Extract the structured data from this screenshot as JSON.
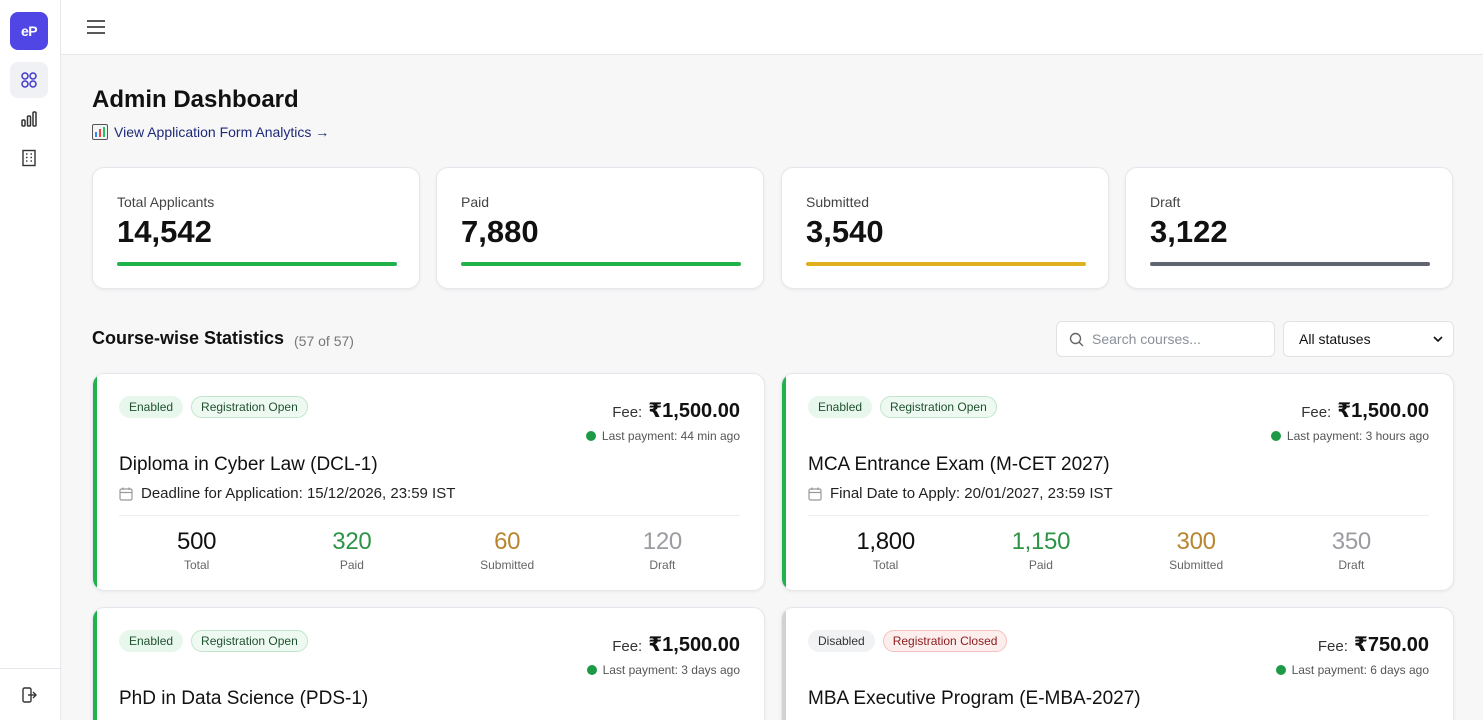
{
  "app": {
    "logo_text": "eP"
  },
  "sidebar": {
    "items": [
      {
        "icon": "dashboard-grid-icon",
        "active": true
      },
      {
        "icon": "bar-chart-icon",
        "active": false
      },
      {
        "icon": "building-icon",
        "active": false
      }
    ],
    "bottom_icon": "logout-icon"
  },
  "topbar": {
    "menu_icon": "hamburger-menu-icon"
  },
  "header": {
    "title": "Admin Dashboard",
    "analytics_link": "View Application Form Analytics →"
  },
  "stats": [
    {
      "label": "Total Applicants",
      "value": "14,542",
      "color": "#22b24c"
    },
    {
      "label": "Paid",
      "value": "7,880",
      "color": "#22b24c"
    },
    {
      "label": "Submitted",
      "value": "3,540",
      "color": "#e0b01f"
    },
    {
      "label": "Draft",
      "value": "3,122",
      "color": "#5f6470"
    }
  ],
  "section": {
    "title": "Course-wise Statistics",
    "count": "(57 of 57)",
    "search_placeholder": "Search courses...",
    "status_filter": "All statuses"
  },
  "courses": [
    {
      "status_badge": "Enabled",
      "registration_badge": "Registration Open",
      "fee_label": "Fee:",
      "fee": "₹1,500.00",
      "last_payment": "Last payment: 44 min ago",
      "title": "Diploma in Cyber Law (DCL-1)",
      "deadline": "Deadline for Application: 15/12/2026, 23:59 IST",
      "total": "500",
      "paid": "320",
      "submitted": "60",
      "draft": "120",
      "total_label": "Total",
      "paid_label": "Paid",
      "submitted_label": "Submitted",
      "draft_label": "Draft",
      "accent": "#22b24c"
    },
    {
      "status_badge": "Enabled",
      "registration_badge": "Registration Open",
      "fee_label": "Fee:",
      "fee": "₹1,500.00",
      "last_payment": "Last payment: 3 hours ago",
      "title": "MCA Entrance Exam (M-CET 2027)",
      "deadline": "Final Date to Apply: 20/01/2027, 23:59 IST",
      "total": "1,800",
      "paid": "1,150",
      "submitted": "300",
      "draft": "350",
      "total_label": "Total",
      "paid_label": "Paid",
      "submitted_label": "Submitted",
      "draft_label": "Draft",
      "accent": "#22b24c"
    },
    {
      "status_badge": "Enabled",
      "registration_badge": "Registration Open",
      "fee_label": "Fee:",
      "fee": "₹1,500.00",
      "last_payment": "Last payment: 3 days ago",
      "title": "PhD in Data Science (PDS-1)",
      "accent": "#22b24c"
    },
    {
      "status_badge": "Disabled",
      "registration_badge": "Registration Closed",
      "fee_label": "Fee:",
      "fee": "₹750.00",
      "last_payment": "Last payment: 6 days ago",
      "title": "MBA Executive Program (E-MBA-2027)",
      "accent": "#d0d2d6"
    }
  ]
}
